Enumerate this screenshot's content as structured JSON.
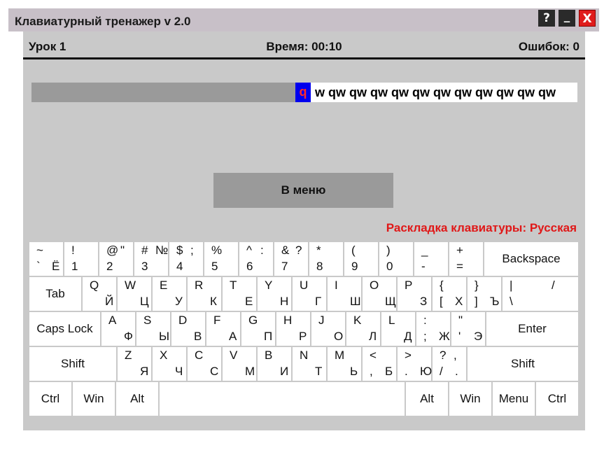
{
  "window": {
    "title": "Клавиатурный тренажер v 2.0",
    "help_label": "?",
    "minimize_label": "_",
    "close_label": "X"
  },
  "status": {
    "lesson": "Урок 1",
    "time": "Время:  00:10",
    "errors": "Ошибок: 0"
  },
  "typing": {
    "current_char": "q",
    "remaining_text": "w qw qw qw qw qw qw qw qw qw qw qw"
  },
  "menu_button_label": "В меню",
  "layout_label": "Раскладка клавиатуры: Русская",
  "colors": {
    "panel_bg": "#c9c9c9",
    "typed_bg": "#9a9a9a",
    "cursor_bg": "#0000ee",
    "cursor_text": "#ff2a2a",
    "layout_text": "#e01818",
    "close_button": "#e01c1c"
  },
  "keyboard": {
    "rows": [
      [
        {
          "id": "backtick",
          "w": 50,
          "tl": "~",
          "bl": "`",
          "br": "Ё"
        },
        {
          "id": "1",
          "w": 50,
          "tl": "!",
          "bl": "1"
        },
        {
          "id": "2",
          "w": 50,
          "tl": "@",
          "tr": "\"",
          "bl": "2"
        },
        {
          "id": "3",
          "w": 50,
          "tl": "#",
          "tr": "№",
          "bl": "3"
        },
        {
          "id": "4",
          "w": 50,
          "tl": "$",
          "tr": ";",
          "bl": "4"
        },
        {
          "id": "5",
          "w": 50,
          "tl": "%",
          "bl": "5"
        },
        {
          "id": "6",
          "w": 50,
          "tl": "^",
          "tr": ":",
          "bl": "6"
        },
        {
          "id": "7",
          "w": 50,
          "tl": "&",
          "tr": "?",
          "bl": "7"
        },
        {
          "id": "8",
          "w": 50,
          "tl": "*",
          "bl": "8"
        },
        {
          "id": "9",
          "w": 50,
          "tl": "(",
          "bl": "9"
        },
        {
          "id": "0",
          "w": 50,
          "tl": ")",
          "bl": "0"
        },
        {
          "id": "minus",
          "w": 50,
          "tl": "_",
          "bl": "-"
        },
        {
          "id": "equal",
          "w": 50,
          "tl": "+",
          "bl": "="
        },
        {
          "id": "backspace",
          "w": 136,
          "label": "Backspace"
        }
      ],
      [
        {
          "id": "tab",
          "w": 76,
          "label": "Tab"
        },
        {
          "id": "q",
          "w": 50,
          "tl": "Q",
          "br": "Й"
        },
        {
          "id": "w",
          "w": 50,
          "tl": "W",
          "br": "Ц"
        },
        {
          "id": "e",
          "w": 50,
          "tl": "E",
          "br": "У"
        },
        {
          "id": "r",
          "w": 50,
          "tl": "R",
          "br": "К"
        },
        {
          "id": "t",
          "w": 50,
          "tl": "T",
          "br": "Е"
        },
        {
          "id": "y",
          "w": 50,
          "tl": "Y",
          "br": "Н"
        },
        {
          "id": "u",
          "w": 50,
          "tl": "U",
          "br": "Г"
        },
        {
          "id": "i",
          "w": 50,
          "tl": "I",
          "br": "Ш"
        },
        {
          "id": "o",
          "w": 50,
          "tl": "O",
          "br": "Щ"
        },
        {
          "id": "p",
          "w": 50,
          "tl": "P",
          "br": "З"
        },
        {
          "id": "lbracket",
          "w": 50,
          "tl": "{",
          "bl": "[",
          "br": "Х"
        },
        {
          "id": "rbracket",
          "w": 50,
          "tl": "}",
          "bl": "]",
          "br": "Ъ"
        },
        {
          "id": "backslash",
          "w": 110,
          "tl": "|",
          "tr": "/",
          "bl": "\\"
        }
      ],
      [
        {
          "id": "capslock",
          "w": 103,
          "label": "Caps Lock"
        },
        {
          "id": "a",
          "w": 50,
          "tl": "A",
          "br": "Ф"
        },
        {
          "id": "s",
          "w": 50,
          "tl": "S",
          "br": "Ы"
        },
        {
          "id": "d",
          "w": 50,
          "tl": "D",
          "br": "В"
        },
        {
          "id": "f",
          "w": 50,
          "tl": "F",
          "br": "А"
        },
        {
          "id": "g",
          "w": 50,
          "tl": "G",
          "br": "П"
        },
        {
          "id": "h",
          "w": 50,
          "tl": "H",
          "br": "Р"
        },
        {
          "id": "j",
          "w": 50,
          "tl": "J",
          "br": "О"
        },
        {
          "id": "k",
          "w": 50,
          "tl": "K",
          "br": "Л"
        },
        {
          "id": "l",
          "w": 50,
          "tl": "L",
          "br": "Д"
        },
        {
          "id": "semicolon",
          "w": 50,
          "tl": ":",
          "bl": ";",
          "br": "Ж"
        },
        {
          "id": "quote",
          "w": 50,
          "tl": "\"",
          "bl": "'",
          "br": "Э"
        },
        {
          "id": "enter",
          "w": 133,
          "label": "Enter"
        }
      ],
      [
        {
          "id": "lshift",
          "w": 126,
          "label": "Shift"
        },
        {
          "id": "z",
          "w": 50,
          "tl": "Z",
          "br": "Я"
        },
        {
          "id": "x",
          "w": 50,
          "tl": "X",
          "br": "Ч"
        },
        {
          "id": "c",
          "w": 50,
          "tl": "C",
          "br": "С"
        },
        {
          "id": "v",
          "w": 50,
          "tl": "V",
          "br": "М"
        },
        {
          "id": "b",
          "w": 50,
          "tl": "B",
          "br": "И"
        },
        {
          "id": "n",
          "w": 50,
          "tl": "N",
          "br": "Т"
        },
        {
          "id": "m",
          "w": 50,
          "tl": "M",
          "br": "Ь"
        },
        {
          "id": "comma",
          "w": 50,
          "tl": "<",
          "bl": ",",
          "br": "Б"
        },
        {
          "id": "period",
          "w": 50,
          "tl": ">",
          "bl": ".",
          "br": "Ю"
        },
        {
          "id": "slash",
          "w": 50,
          "tl": "?",
          "tr": ",",
          "bl": "/",
          "br": "."
        },
        {
          "id": "rshift",
          "w": 160,
          "label": "Shift"
        }
      ],
      [
        {
          "id": "lctrl",
          "w": 62,
          "label": "Ctrl"
        },
        {
          "id": "lwin",
          "w": 62,
          "label": "Win"
        },
        {
          "id": "lalt",
          "w": 62,
          "label": "Alt"
        },
        {
          "id": "space",
          "w": 352,
          "label": ""
        },
        {
          "id": "ralt",
          "w": 62,
          "label": "Alt"
        },
        {
          "id": "rwin",
          "w": 62,
          "label": "Win"
        },
        {
          "id": "menu",
          "w": 62,
          "label": "Menu"
        },
        {
          "id": "rctrl",
          "w": 62,
          "label": "Ctrl"
        }
      ]
    ]
  }
}
